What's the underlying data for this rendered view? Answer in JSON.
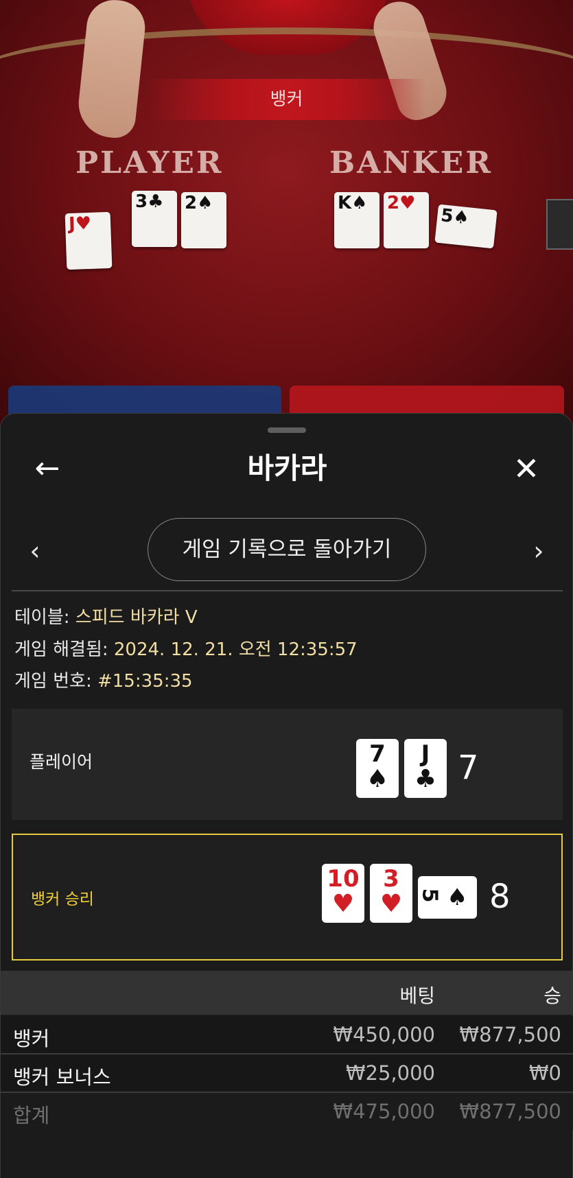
{
  "live_table": {
    "winner_banner": "뱅커",
    "player_label": "PLAYER",
    "banker_label": "BANKER",
    "player_cards": [
      {
        "rank": "J",
        "suit": "♥",
        "color": "red"
      },
      {
        "rank": "3",
        "suit": "♣",
        "color": "black"
      },
      {
        "rank": "2",
        "suit": "♠",
        "color": "black"
      }
    ],
    "banker_cards": [
      {
        "rank": "K",
        "suit": "♠",
        "color": "black"
      },
      {
        "rank": "2",
        "suit": "♥",
        "color": "red"
      },
      {
        "rank": "5",
        "suit": "♠",
        "color": "black"
      }
    ]
  },
  "sheet": {
    "title": "바카라",
    "back_icon": "←",
    "close_icon": "✕",
    "prev_icon": "‹",
    "next_icon": "›",
    "history_button": "게임 기록으로 돌아가기"
  },
  "info": {
    "table_label": "테이블: ",
    "table_value": "스피드 바카라 V",
    "resolved_label": "게임 해결됨: ",
    "resolved_value": "2024. 12. 21. 오전 12:35:57",
    "number_label": "게임 번호: ",
    "number_value": "#15:35:35"
  },
  "result": {
    "player": {
      "label": "플레이어",
      "cards": [
        {
          "rank": "7",
          "suit": "♠",
          "color": "black"
        },
        {
          "rank": "J",
          "suit": "♣",
          "color": "black"
        }
      ],
      "total": "7"
    },
    "banker": {
      "label": "뱅커 승리",
      "cards": [
        {
          "rank": "10",
          "suit": "♥",
          "color": "red"
        },
        {
          "rank": "3",
          "suit": "♥",
          "color": "red"
        },
        {
          "rank": "5",
          "suit": "♠",
          "color": "black",
          "sideways": true
        }
      ],
      "total": "8"
    }
  },
  "bets": {
    "header_bet": "베팅",
    "header_win": "승",
    "rows": [
      {
        "name": "뱅커",
        "bet": "₩450,000",
        "win": "₩877,500"
      },
      {
        "name": "뱅커 보너스",
        "bet": "₩25,000",
        "win": "₩0"
      }
    ],
    "total": {
      "name": "합계",
      "bet": "₩475,000",
      "win": "₩877,500"
    }
  },
  "colors": {
    "accent_yellow": "#f1cf38",
    "info_value": "#f2dfa3",
    "table_red": "#8e1a1f"
  }
}
